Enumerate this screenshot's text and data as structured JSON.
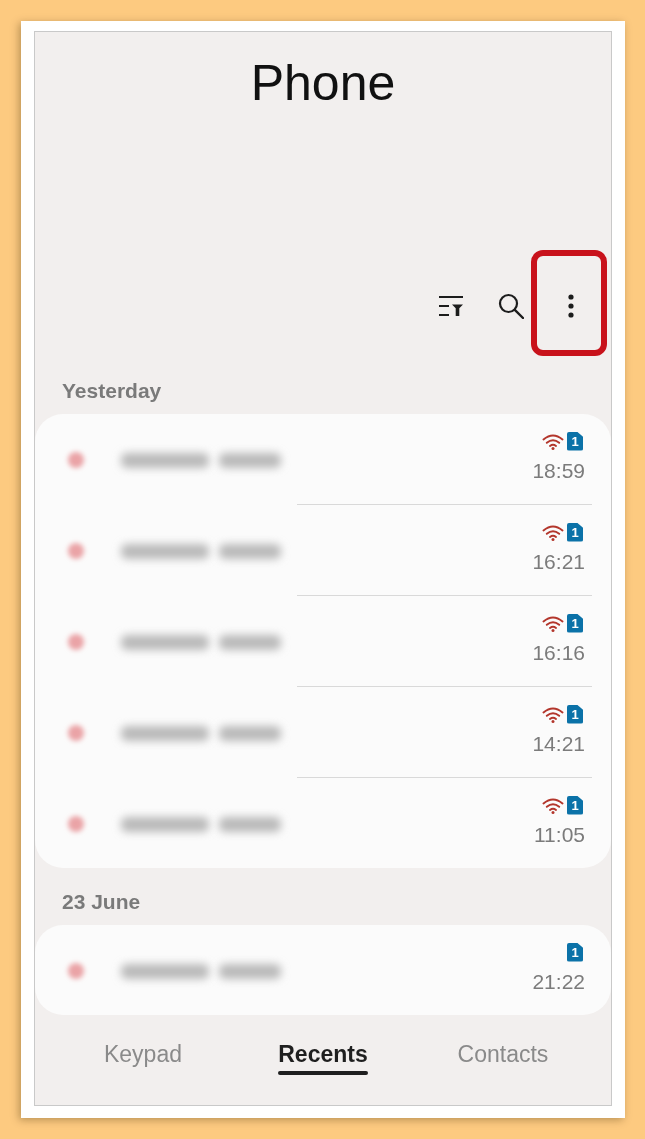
{
  "app": {
    "title": "Phone"
  },
  "toolbar": [
    {
      "kind": "filter",
      "highlighted": false
    },
    {
      "kind": "search",
      "highlighted": false
    },
    {
      "kind": "more",
      "highlighted": true
    }
  ],
  "sections": [
    {
      "label": "Yesterday",
      "calls": [
        {
          "wifi_calling": true,
          "sim": "1",
          "time": "18:59"
        },
        {
          "wifi_calling": true,
          "sim": "1",
          "time": "16:21"
        },
        {
          "wifi_calling": true,
          "sim": "1",
          "time": "16:16"
        },
        {
          "wifi_calling": true,
          "sim": "1",
          "time": "14:21"
        },
        {
          "wifi_calling": true,
          "sim": "1",
          "time": "11:05"
        }
      ]
    },
    {
      "label": "23 June",
      "calls": [
        {
          "wifi_calling": false,
          "sim": "1",
          "time": "21:22"
        }
      ]
    }
  ],
  "tabs": [
    {
      "label": "Keypad",
      "selected": false
    },
    {
      "label": "Recents",
      "selected": true
    },
    {
      "label": "Contacts",
      "selected": false
    }
  ]
}
